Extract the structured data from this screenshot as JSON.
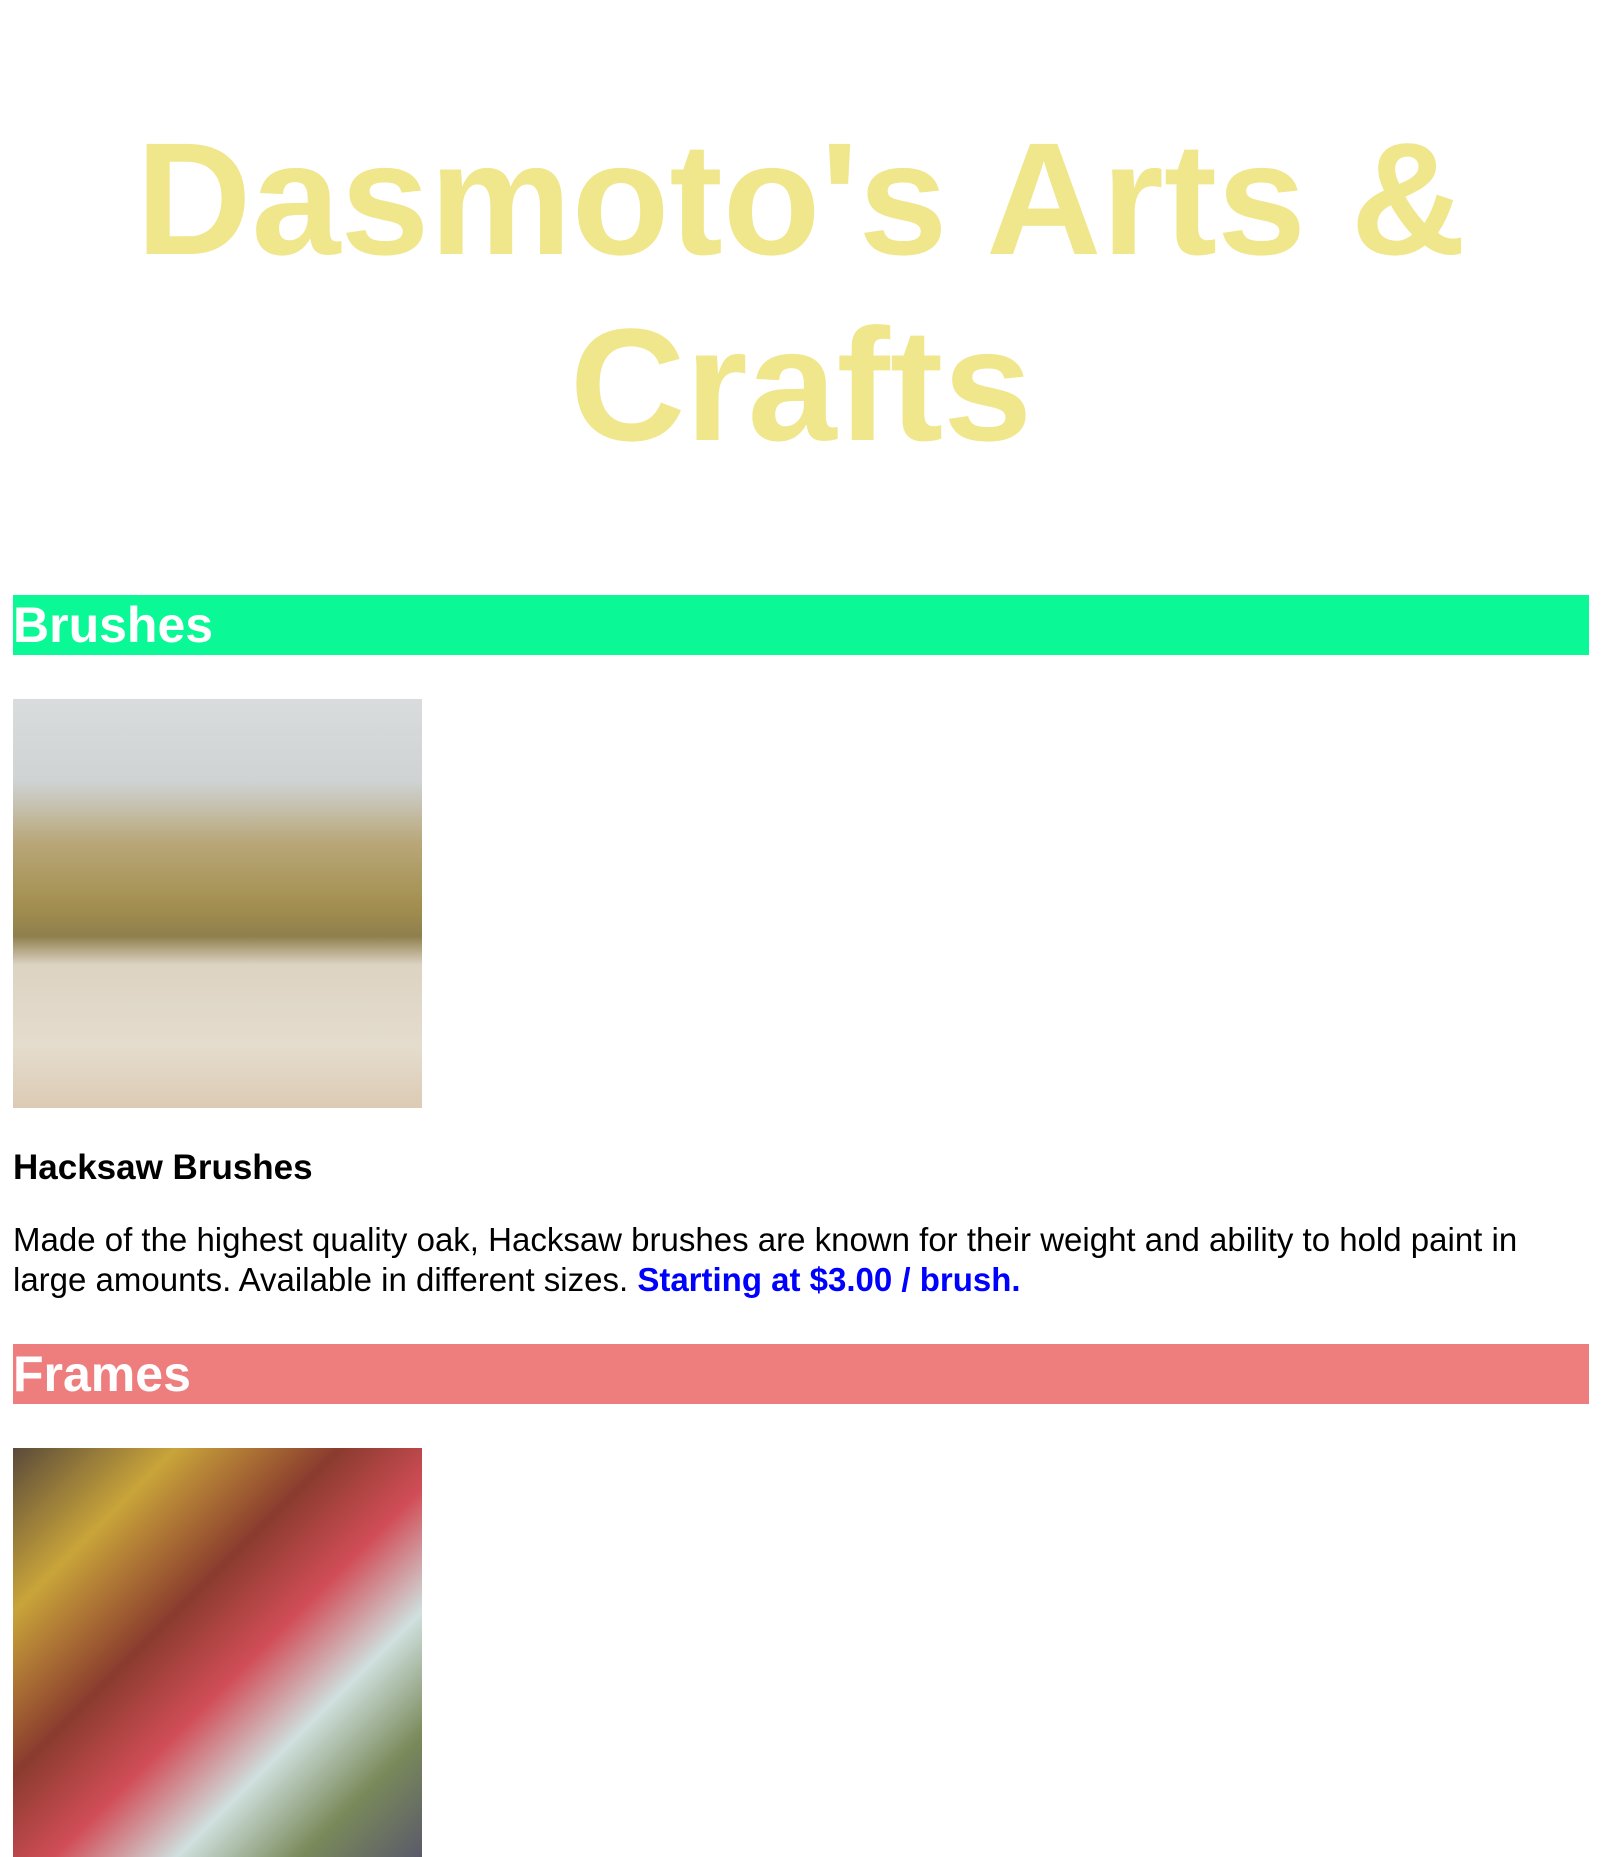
{
  "header": {
    "title": "Dasmoto's Arts & Crafts"
  },
  "colors": {
    "title": "#F0E68C",
    "brushes": "#0AF996",
    "frames": "#EE7E7E",
    "price": "#0000FF"
  },
  "brushes": {
    "heading": "Brushes",
    "item_title": "Hacksaw Brushes",
    "description": "Made of the highest quality oak, Hacksaw brushes are known for their weight and ability to hold paint in large amounts. Available in different sizes. ",
    "price": "Starting at $3.00 / brush."
  },
  "frames": {
    "heading": "Frames"
  }
}
